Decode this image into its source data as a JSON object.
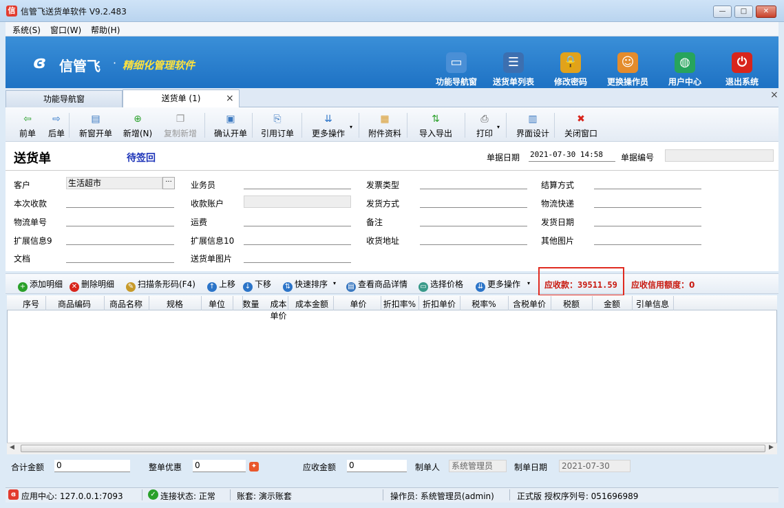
{
  "window": {
    "title": "信管飞送货单软件 V9.2.483",
    "app_icon": "信",
    "controls": {
      "minimize": "—",
      "maximize": "□",
      "close": "✕"
    }
  },
  "menu": [
    "系统(S)",
    "窗口(W)",
    "帮助(H)"
  ],
  "banner": {
    "logo": "信管飞",
    "dot": "·",
    "slogan": "精细化管理软件",
    "nav": [
      {
        "label": "功能导航窗",
        "icon": "monitor-icon",
        "glyph": "▭",
        "color": "#4a8fd6"
      },
      {
        "label": "送货单列表",
        "icon": "list-icon",
        "glyph": "☰",
        "color": "#3c6fb0"
      },
      {
        "label": "修改密码",
        "icon": "lock-icon",
        "glyph": "🔒",
        "color": "#e1a21c"
      },
      {
        "label": "更换操作员",
        "icon": "user-icon",
        "glyph": "☺",
        "color": "#e48c2c"
      },
      {
        "label": "用户中心",
        "icon": "globe-icon",
        "glyph": "◍",
        "color": "#27a45c"
      },
      {
        "label": "退出系统",
        "icon": "power-icon",
        "glyph": "⏻",
        "color": "#d8251c"
      }
    ]
  },
  "tabs": {
    "nav": "功能导航窗",
    "delivery": "送货单 (1)",
    "close": "×",
    "panel_close": "×"
  },
  "toolbar": [
    {
      "label": "前单",
      "icon": "arrow-left-icon",
      "glyph": "⇦",
      "color": "#2aa02a",
      "disabled": false
    },
    {
      "label": "后单",
      "icon": "arrow-right-icon",
      "glyph": "⇨",
      "color": "#2b74c8",
      "disabled": false
    },
    {
      "label": "新窗开单",
      "icon": "new-window-icon",
      "glyph": "▤",
      "color": "#3a78c0",
      "disabled": false
    },
    {
      "label": "新增(N)",
      "icon": "add-icon",
      "glyph": "⊕",
      "color": "#2aa02a",
      "disabled": false
    },
    {
      "label": "复制新增",
      "icon": "copy-icon",
      "glyph": "❐",
      "color": "#999",
      "disabled": true
    },
    {
      "label": "确认开单",
      "icon": "save-icon",
      "glyph": "▣",
      "color": "#3a78c0",
      "disabled": false
    },
    {
      "label": "引用订单",
      "icon": "import-order-icon",
      "glyph": "⎘",
      "color": "#3a78c0",
      "disabled": false
    },
    {
      "label": "更多操作",
      "icon": "more-icon",
      "glyph": "⇊",
      "color": "#2b74c8",
      "disabled": false
    },
    {
      "label": "附件资料",
      "icon": "attachment-icon",
      "glyph": "▦",
      "color": "#d99a2a",
      "disabled": false
    },
    {
      "label": "导入导出",
      "icon": "import-export-icon",
      "glyph": "⇅",
      "color": "#2aa02a",
      "disabled": false
    },
    {
      "label": "打印",
      "icon": "print-icon",
      "glyph": "⎙",
      "color": "#555",
      "disabled": false
    },
    {
      "label": "界面设计",
      "icon": "layout-icon",
      "glyph": "▥",
      "color": "#3a78c0",
      "disabled": false
    },
    {
      "label": "关闭窗口",
      "icon": "close-window-icon",
      "glyph": "✖",
      "color": "#d8251c",
      "disabled": false
    }
  ],
  "doc": {
    "title": "送货单",
    "status": "待签回",
    "date_label": "单据日期",
    "date_value": "2021-07-30 14:58",
    "number_label": "单据编号",
    "number_value": ""
  },
  "fields": {
    "customer": {
      "label": "客户",
      "value": "生活超市",
      "picker": "···"
    },
    "salesman": {
      "label": "业务员",
      "value": ""
    },
    "invoice_type": {
      "label": "发票类型",
      "value": ""
    },
    "settlement": {
      "label": "结算方式",
      "value": ""
    },
    "received": {
      "label": "本次收款",
      "value": ""
    },
    "account": {
      "label": "收款账户",
      "value": ""
    },
    "ship_method": {
      "label": "发货方式",
      "value": ""
    },
    "logistics": {
      "label": "物流快递",
      "value": ""
    },
    "tracking": {
      "label": "物流单号",
      "value": ""
    },
    "freight": {
      "label": "运费",
      "value": ""
    },
    "remark": {
      "label": "备注",
      "value": ""
    },
    "ship_date": {
      "label": "发货日期",
      "value": ""
    },
    "ext9": {
      "label": "扩展信息9",
      "value": ""
    },
    "ext10": {
      "label": "扩展信息10",
      "value": ""
    },
    "address": {
      "label": "收货地址",
      "value": ""
    },
    "other_image": {
      "label": "其他图片",
      "value": ""
    },
    "document": {
      "label": "文档",
      "value": ""
    },
    "delivery_image": {
      "label": "送货单图片",
      "value": ""
    }
  },
  "detail_toolbar": [
    {
      "label": "添加明细",
      "icon": "add-detail-icon",
      "glyph": "+",
      "color": "#2aa02a"
    },
    {
      "label": "删除明细",
      "icon": "delete-detail-icon",
      "glyph": "✕",
      "color": "#d8251c"
    },
    {
      "label": "扫描条形码(F4)",
      "icon": "barcode-icon",
      "glyph": "✎",
      "color": "#c79a2a"
    },
    {
      "label": "上移",
      "icon": "up-icon",
      "glyph": "↑",
      "color": "#2b74c8"
    },
    {
      "label": "下移",
      "icon": "down-icon",
      "glyph": "↓",
      "color": "#2b74c8"
    },
    {
      "label": "快速排序",
      "icon": "sort-icon",
      "glyph": "⇅",
      "color": "#2b74c8"
    },
    {
      "label": "查看商品详情",
      "icon": "detail-icon",
      "glyph": "▤",
      "color": "#3a78c0"
    },
    {
      "label": "选择价格",
      "icon": "price-icon",
      "glyph": "▭",
      "color": "#3a9a8a"
    },
    {
      "label": "更多操作",
      "icon": "more-icon",
      "glyph": "⇊",
      "color": "#2b74c8"
    }
  ],
  "receivable": {
    "label": "应收款：",
    "value": "39511.59"
  },
  "credit": {
    "label": "应收信用额度：",
    "value": "0"
  },
  "grid": {
    "columns": [
      "序号",
      "商品编码",
      "商品名称",
      "规格",
      "单位",
      "数量",
      "成本单价",
      "成本金额",
      "单价",
      "折扣率%",
      "折扣单价",
      "税率%",
      "含税单价",
      "税额",
      "金额",
      "引单信息"
    ],
    "rows": []
  },
  "footer": {
    "total_label": "合计金额",
    "total_value": "0",
    "discount_label": "整单优惠",
    "discount_value": "0",
    "due_label": "应收金额",
    "due_value": "0",
    "maker_label": "制单人",
    "maker_value": "系统管理员",
    "make_date_label": "制单日期",
    "make_date_value": "2021-07-30"
  },
  "status": {
    "app_center": "应用中心: 127.0.0.1:7093",
    "connection": "连接状态: 正常",
    "account_set": "账套: 演示账套",
    "operator": "操作员: 系统管理员(admin)",
    "license": "正式版 授权序列号: 051696989"
  },
  "colors": {
    "banner": "#2a82d0",
    "slogan": "#ffe23d",
    "alert": "#c8190f",
    "status_blue": "#1c33b8"
  }
}
